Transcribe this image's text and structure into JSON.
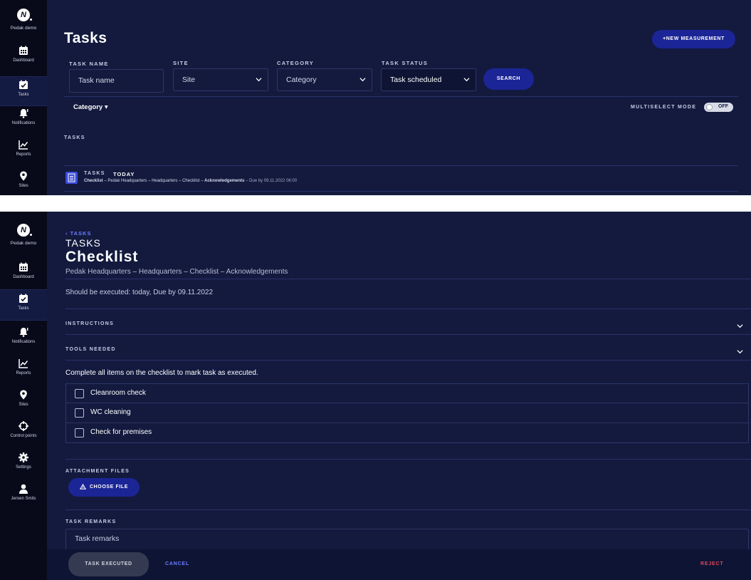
{
  "sidebar": {
    "org_name": "Pedak demo",
    "top_items": [
      {
        "label": "Dashboard",
        "icon": "calendar-icon"
      },
      {
        "label": "Tasks",
        "icon": "calendar-check-icon"
      },
      {
        "label": "Notifications",
        "icon": "bell-icon"
      },
      {
        "label": "Reports",
        "icon": "chart-icon"
      },
      {
        "label": "Sites",
        "icon": "map-pin-icon"
      }
    ],
    "bottom_items": [
      {
        "label": "Dashboard",
        "icon": "calendar-icon"
      },
      {
        "label": "Tasks",
        "icon": "calendar-check-icon"
      },
      {
        "label": "Notifications",
        "icon": "bell-icon"
      },
      {
        "label": "Reports",
        "icon": "chart-icon"
      },
      {
        "label": "Sites",
        "icon": "map-pin-icon"
      },
      {
        "label": "Control points",
        "icon": "crosshair-icon"
      },
      {
        "label": "Settings",
        "icon": "gear-icon"
      },
      {
        "label": "Jeroen Smits",
        "icon": "user-icon"
      }
    ]
  },
  "tasks_page": {
    "title": "Tasks",
    "new_measurement_label": "+NEW MEASUREMENT",
    "filters": {
      "task_name_label": "TASK NAME",
      "task_name_placeholder": "Task name",
      "site_label": "SITE",
      "site_value": "Site",
      "category_label": "CATEGORY",
      "category_value": "Category",
      "status_label": "TASK STATUS",
      "status_value": "Task scheduled",
      "search_label": "SEARCH"
    },
    "category_sort_label": "Category ▾",
    "multiselect_label": "MULTISELECT MODE",
    "multiselect_state": "OFF",
    "tasks_section_label": "TASKS",
    "task_row": {
      "group": "TASKS",
      "when": "TODAY",
      "name": "Checklist",
      "path": "– Pedak Headquarters – Headquarters – Checklist –",
      "path_bold": "Acknowledgements",
      "due": "– Due by 09.11.2022 06:00"
    }
  },
  "detail_page": {
    "back_link": "‹ TASKS",
    "section": "TASKS",
    "title": "Checklist",
    "breadcrumb": "Pedak Headquarters – Headquarters – Checklist – Acknowledgements",
    "schedule": "Should be executed: today, Due by 09.11.2022",
    "instructions_label": "INSTRUCTIONS",
    "tools_label": "TOOLS NEEDED",
    "checklist_hint": "Complete all items on the checklist to mark task as executed.",
    "checklist_items": [
      "Cleanroom check",
      "WC cleaning",
      "Check for premises"
    ],
    "attachments_label": "ATTACHMENT FILES",
    "choose_file_label": "CHOOSE FILE",
    "remarks_label": "TASK REMARKS",
    "remarks_placeholder": "Task remarks",
    "task_executed_label": "TASK EXECUTED",
    "cancel_label": "CANCEL",
    "reject_label": "REJECT"
  },
  "colors": {
    "background": "#131a3e",
    "sidebar": "#080a1a",
    "accent": "#1b2596",
    "reject": "#e2465c"
  }
}
